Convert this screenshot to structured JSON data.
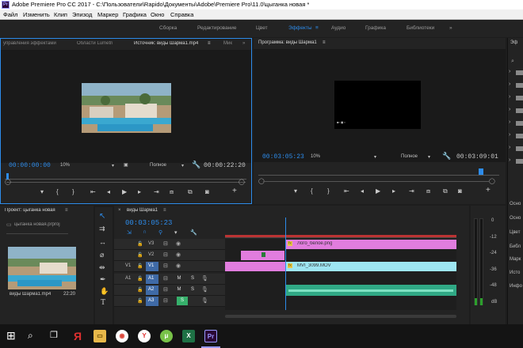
{
  "window": {
    "title": "Adobe Premiere Pro CC 2017 - C:\\Пользователи\\Rapido\\Документы\\Adobe\\Premiere Pro\\11.0\\цыганка новая *",
    "app_icon": "Pr"
  },
  "menu": [
    "Файл",
    "Изменить",
    "Клип",
    "Эпизод",
    "Маркер",
    "Графика",
    "Окно",
    "Справка"
  ],
  "workspaces": {
    "items": [
      "Сборка",
      "Редактирование",
      "Цвет",
      "Эффекты",
      "Аудио",
      "Графика",
      "Библиотеки"
    ],
    "active": "Эффекты",
    "more": "»"
  },
  "source_panel": {
    "tabs": [
      "управления эффектами",
      "Области Lumetri",
      "Источник: виды Шарма1.mp4",
      "Мик"
    ],
    "active_tab": "Источник: виды Шарма1.mp4",
    "timecode_in": "00:00:00:00",
    "zoom": "10%",
    "quality": "Полное",
    "timecode_out": "00:00:22:20"
  },
  "program_panel": {
    "tab": "Программа: виды Шарма1",
    "timecode_in": "00:03:05:23",
    "zoom": "10%",
    "quality": "Полное",
    "timecode_out": "00:03:09:01",
    "preview_caption": "■▪ ◼ ▪"
  },
  "effects_panel": {
    "tab": "Эф",
    "rows": 8,
    "side_labels": [
      "Осно",
      "Осно",
      "Цвет",
      "Библ",
      "Марк",
      "Исто",
      "Инфо"
    ]
  },
  "project_panel": {
    "title": "Проект: цыганка новая",
    "file": "цыганка новая.prproj",
    "clip_name": "виды Шарма1.mp4",
    "clip_duration": "22:20"
  },
  "timeline": {
    "tab": "виды Шарма1",
    "timecode": "00:03:05:23",
    "video_tracks": [
      "V3",
      "V2",
      "V1"
    ],
    "audio_tracks": [
      "A1",
      "A2",
      "A3"
    ],
    "src_v": "V1",
    "src_a": "A1",
    "clips": {
      "v3": "Лого_белое.png",
      "v1": "MVI_3099.MOV",
      "fx": "fx"
    },
    "buttons": {
      "mute": "M",
      "solo": "S"
    }
  },
  "meter_scale": [
    "0",
    "-12",
    "-24",
    "-36",
    "-48",
    "dB"
  ],
  "colors": {
    "accent": "#2d8ceb",
    "clip_pink": "#e17dde",
    "clip_cyan": "#9ee6f2",
    "clip_green": "#30a985",
    "track_v1": "#3f6aa6",
    "solo_green": "#36b06b"
  },
  "taskbar": {
    "apps": [
      "windows-start",
      "search",
      "task-view",
      "yandex",
      "explorer",
      "chrome",
      "yandex-browser",
      "utorrent",
      "excel",
      "premiere"
    ]
  }
}
